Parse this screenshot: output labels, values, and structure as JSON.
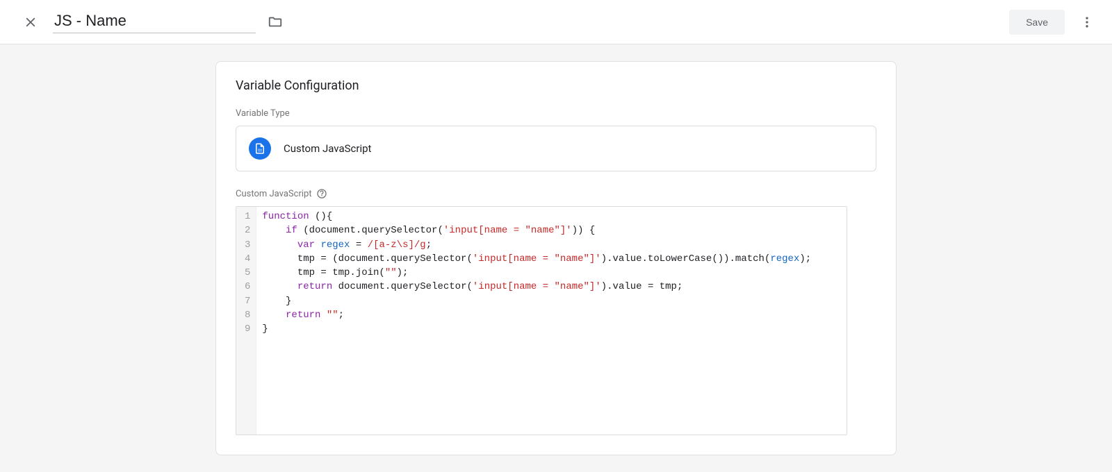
{
  "header": {
    "title_value": "JS - Name",
    "save_label": "Save"
  },
  "card": {
    "title": "Variable Configuration",
    "type_label": "Variable Type",
    "type_name": "Custom JavaScript",
    "editor_label": "Custom JavaScript"
  },
  "code": {
    "line_count": 9,
    "raw": "function (){\n    if (document.querySelector('input[name = \"name\"]')) {\n      var regex = /[a-z\\s]/g;\n      tmp = (document.querySelector('input[name = \"name\"]').value.toLowerCase()).match(regex);\n      tmp = tmp.join(\"\");\n      return document.querySelector('input[name = \"name\"]').value = tmp;\n    }\n    return \"\";\n}",
    "tokens": [
      [
        {
          "t": "function",
          "c": "kw"
        },
        {
          "t": " (){",
          "c": "pn"
        }
      ],
      [
        {
          "t": "    ",
          "c": "pn"
        },
        {
          "t": "if",
          "c": "kw"
        },
        {
          "t": " (document.querySelector(",
          "c": "pn"
        },
        {
          "t": "'input[name = \"name\"]'",
          "c": "str"
        },
        {
          "t": ")) {",
          "c": "pn"
        }
      ],
      [
        {
          "t": "      ",
          "c": "pn"
        },
        {
          "t": "var",
          "c": "kw"
        },
        {
          "t": " ",
          "c": "pn"
        },
        {
          "t": "regex",
          "c": "var"
        },
        {
          "t": " = ",
          "c": "pn"
        },
        {
          "t": "/[a-z\\s]/g",
          "c": "re"
        },
        {
          "t": ";",
          "c": "pn"
        }
      ],
      [
        {
          "t": "      tmp = (document.querySelector(",
          "c": "pn"
        },
        {
          "t": "'input[name = \"name\"]'",
          "c": "str"
        },
        {
          "t": ").value.toLowerCase()).match(",
          "c": "pn"
        },
        {
          "t": "regex",
          "c": "var"
        },
        {
          "t": ");",
          "c": "pn"
        }
      ],
      [
        {
          "t": "      tmp = tmp.join(",
          "c": "pn"
        },
        {
          "t": "\"\"",
          "c": "str"
        },
        {
          "t": ");",
          "c": "pn"
        }
      ],
      [
        {
          "t": "      ",
          "c": "pn"
        },
        {
          "t": "return",
          "c": "kw"
        },
        {
          "t": " document.querySelector(",
          "c": "pn"
        },
        {
          "t": "'input[name = \"name\"]'",
          "c": "str"
        },
        {
          "t": ").value = tmp;",
          "c": "pn"
        }
      ],
      [
        {
          "t": "    }",
          "c": "pn"
        }
      ],
      [
        {
          "t": "    ",
          "c": "pn"
        },
        {
          "t": "return",
          "c": "kw"
        },
        {
          "t": " ",
          "c": "pn"
        },
        {
          "t": "\"\"",
          "c": "str"
        },
        {
          "t": ";",
          "c": "pn"
        }
      ],
      [
        {
          "t": "}",
          "c": "pn"
        }
      ]
    ]
  }
}
